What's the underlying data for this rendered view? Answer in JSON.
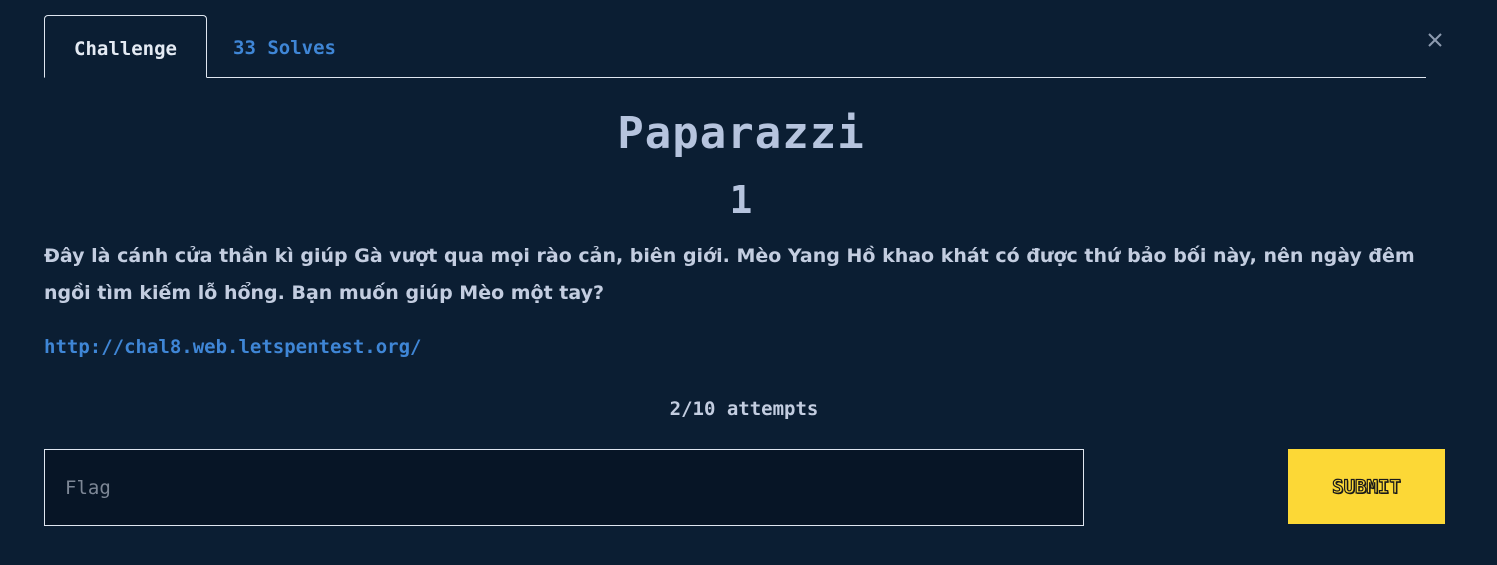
{
  "tabs": {
    "challenge_label": "Challenge",
    "solves_label": "33 Solves"
  },
  "close_icon": "close-icon",
  "challenge": {
    "name": "Paparazzi",
    "points": "1",
    "description": "Đây là cánh cửa thần kì giúp Gà vượt qua mọi rào cản, biên giới. Mèo Yang Hồ khao khát có được thứ bảo bối này, nên ngày đêm ngồi tìm kiếm lỗ hổng. Bạn muốn giúp Mèo một tay?",
    "link": "http://chal8.web.letspentest.org/",
    "attempts": "2/10 attempts"
  },
  "flag_form": {
    "placeholder": "Flag",
    "value": "",
    "submit_label": "SUBMIT"
  },
  "colors": {
    "background": "#0b1e33",
    "accent": "#3f86d6",
    "submit": "#fcd836"
  }
}
